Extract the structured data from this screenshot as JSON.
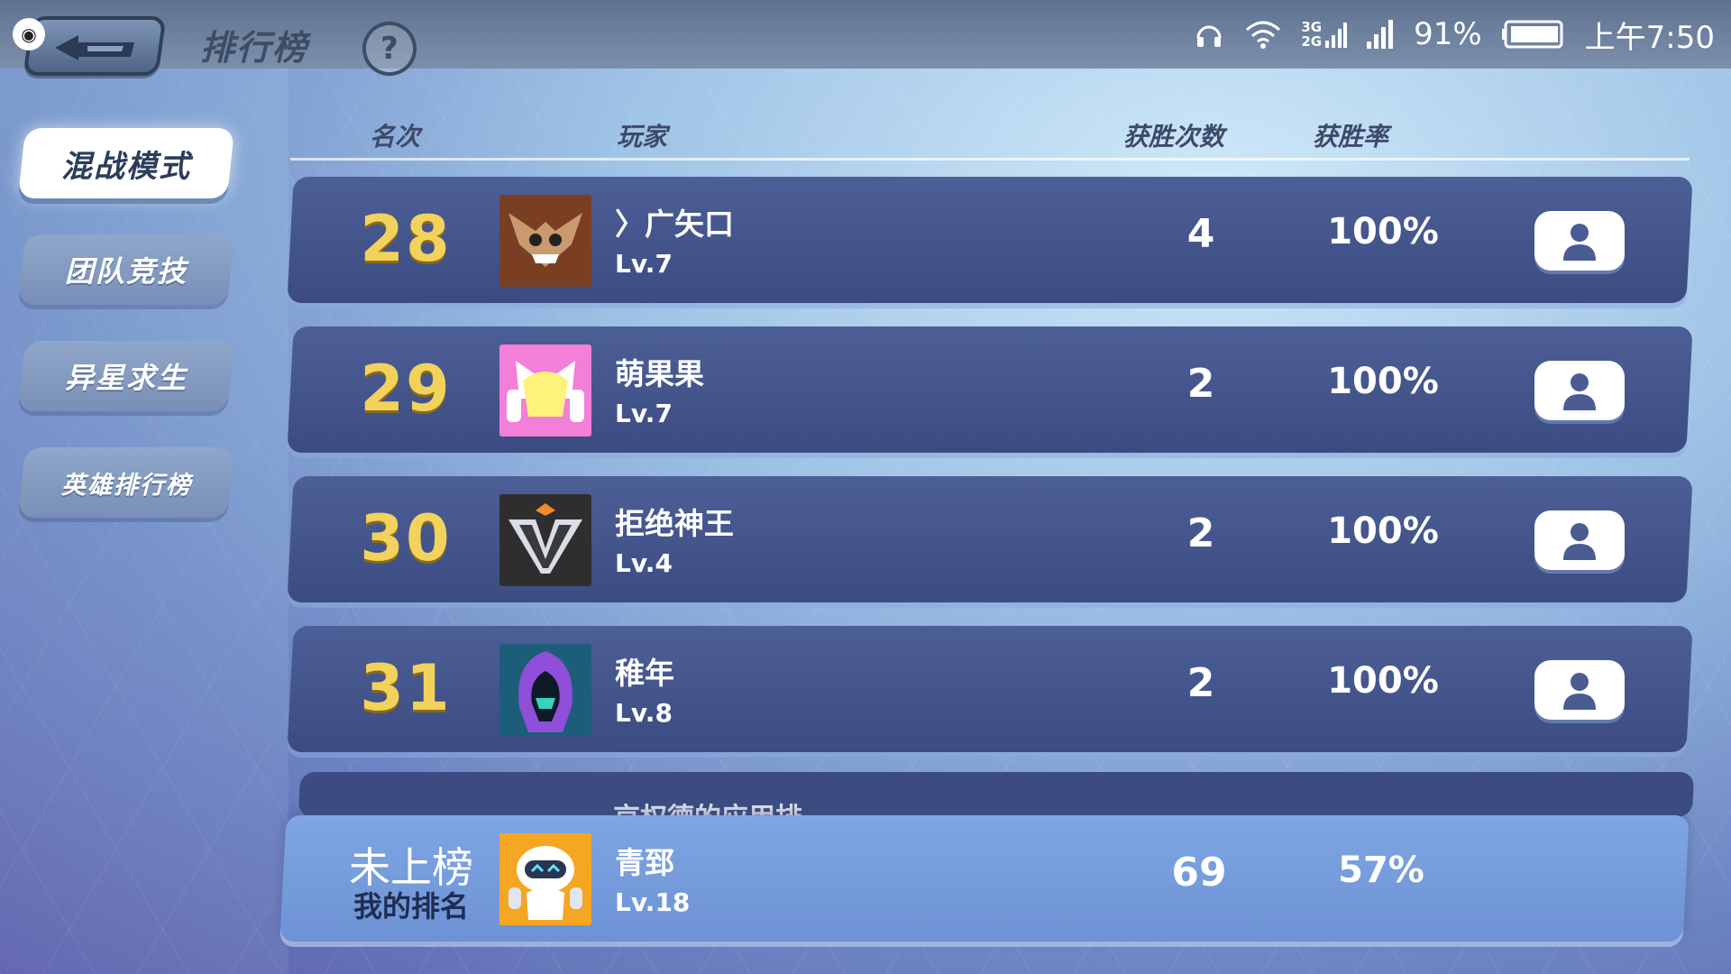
{
  "status_bar": {
    "network_top": "3G",
    "network_bottom": "2G",
    "battery": "91%",
    "time": "上午7:50"
  },
  "header": {
    "title": "排行榜",
    "help_label": "?"
  },
  "tabs": [
    {
      "label": "混战模式",
      "active": true
    },
    {
      "label": "团队竞技",
      "active": false
    },
    {
      "label": "异星求生",
      "active": false
    },
    {
      "label": "英雄排行榜",
      "active": false
    }
  ],
  "columns": {
    "rank": "名次",
    "player": "玩家",
    "wins": "获胜次数",
    "win_rate": "获胜率"
  },
  "rows": [
    {
      "rank": "28",
      "name": "〉广矢口",
      "level": "Lv.7",
      "wins": "4",
      "rate": "100%",
      "avatar": "bat-monster-avatar"
    },
    {
      "rank": "29",
      "name": "萌果果",
      "level": "Lv.7",
      "wins": "2",
      "rate": "100%",
      "avatar": "pink-cat-headphones-avatar"
    },
    {
      "rank": "30",
      "name": "拒绝神王",
      "level": "Lv.4",
      "wins": "2",
      "rate": "100%",
      "avatar": "v-emblem-avatar"
    },
    {
      "rank": "31",
      "name": "稚年",
      "level": "Lv.8",
      "wins": "2",
      "rate": "100%",
      "avatar": "hooded-figure-avatar"
    }
  ],
  "peek_row": {
    "name": "京权德的应用排"
  },
  "my_rank": {
    "status": "未上榜",
    "label": "我的排名",
    "name": "青郅",
    "level": "Lv.18",
    "wins": "69",
    "rate": "57%",
    "avatar": "white-robot-avatar"
  }
}
